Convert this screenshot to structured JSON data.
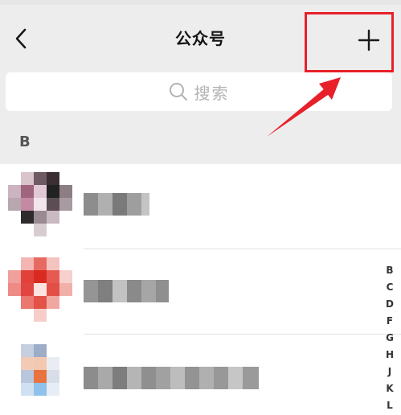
{
  "nav": {
    "title": "公众号",
    "back_icon": "chevron-left-icon",
    "add_icon": "plus-icon"
  },
  "search": {
    "placeholder": "搜索",
    "icon": "search-icon"
  },
  "sections": [
    {
      "letter": "B"
    }
  ],
  "index_letters": [
    "B",
    "C",
    "D",
    "F",
    "G",
    "H",
    "J",
    "K",
    "L"
  ],
  "annotation": {
    "box_color": "#e8202a",
    "arrow_color": "#e8202a"
  }
}
